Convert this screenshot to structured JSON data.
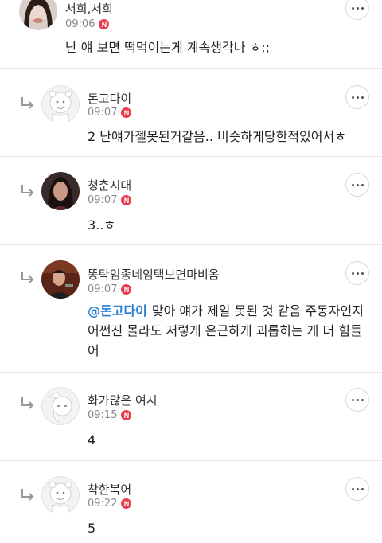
{
  "comments": [
    {
      "name": "서희,서희",
      "time": "09:06",
      "badge": "N",
      "text": "난 얘 보면 떡먹이는게 계속생각나 ㅎ;;",
      "avatar": "photo-avatar",
      "reply": false
    },
    {
      "name": "돈고다이",
      "time": "09:07",
      "badge": "N",
      "text": "2 난얘가젤못된거같음.. 비슷하게당한적있어서ㅎ",
      "avatar": "default-character-avatar",
      "reply": true
    },
    {
      "name": "청춘시대",
      "time": "09:07",
      "badge": "N",
      "text": "3..ㅎ",
      "avatar": "photo-avatar",
      "reply": true
    },
    {
      "name": "똥탁임종네임택보면마비옴",
      "time": "09:07",
      "badge": "N",
      "mention": "@돈고다이",
      "text": "맞아 얘가 제일 못된 것 같음 주동자인지 어쩐진 몰라도 저렇게 은근하게 괴롭히는 게 더 힘들어",
      "avatar": "photo-avatar",
      "reply": true
    },
    {
      "name": "화가많은 여시",
      "time": "09:15",
      "badge": "N",
      "text": "4",
      "avatar": "default-character-avatar",
      "reply": true
    },
    {
      "name": "착한복어",
      "time": "09:22",
      "badge": "N",
      "text": "5",
      "avatar": "default-character-avatar",
      "reply": true
    }
  ],
  "colors": {
    "badge": "#ea3b4e",
    "mention": "#2a7fd4",
    "divider": "#e6e6e6"
  },
  "icons": {
    "reply": "reply-arrow-icon",
    "more": "more-options-icon"
  }
}
